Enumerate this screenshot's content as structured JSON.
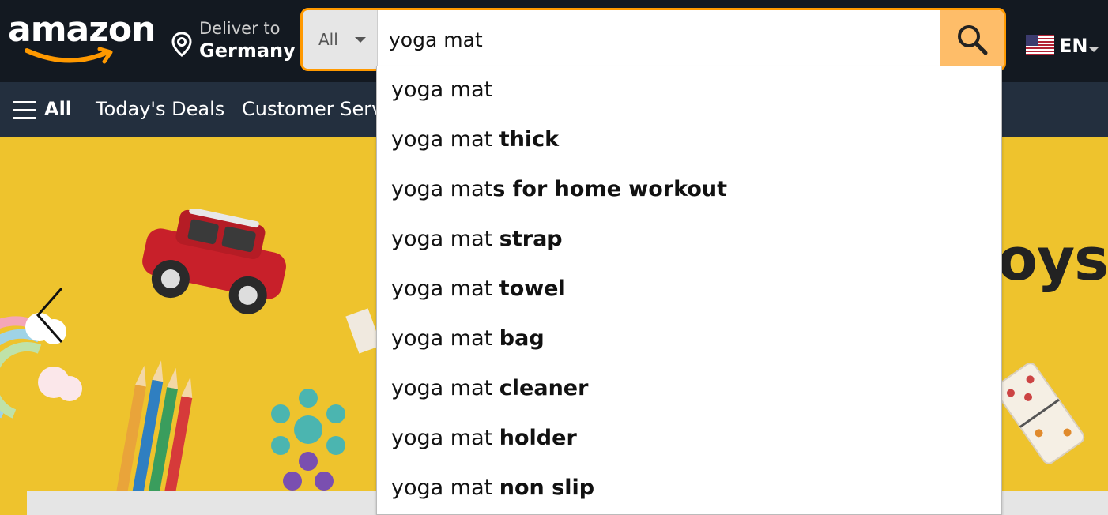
{
  "header": {
    "logo_text": "amazon",
    "deliver_line1": "Deliver to",
    "deliver_line2": "Germany",
    "search": {
      "category": "All",
      "query": "yoga mat"
    },
    "language": "EN"
  },
  "subnav": {
    "all_label": "All",
    "links": [
      "Today's Deals",
      "Customer Servi"
    ]
  },
  "hero": {
    "headline_fragment": "oys"
  },
  "suggestions": [
    {
      "prefix": "yoga mat",
      "suffix": ""
    },
    {
      "prefix": "yoga mat ",
      "suffix": "thick"
    },
    {
      "prefix": "yoga mat",
      "suffix": "s for home workout"
    },
    {
      "prefix": "yoga mat ",
      "suffix": "strap"
    },
    {
      "prefix": "yoga mat ",
      "suffix": "towel"
    },
    {
      "prefix": "yoga mat ",
      "suffix": "bag"
    },
    {
      "prefix": "yoga mat ",
      "suffix": "cleaner"
    },
    {
      "prefix": "yoga mat ",
      "suffix": "holder"
    },
    {
      "prefix": "yoga mat ",
      "suffix": "non slip"
    }
  ],
  "colors": {
    "nav_dark": "#131921",
    "nav_sub": "#232f3e",
    "accent_orange": "#ff9900",
    "search_button": "#febd69",
    "hero_yellow": "#eec32d"
  }
}
